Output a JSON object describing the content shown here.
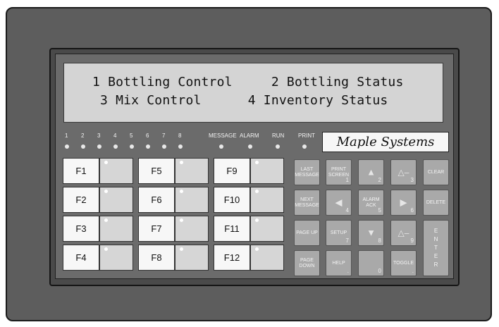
{
  "display": {
    "line1": "1 Bottling Control     2 Bottling Status",
    "line2": " 3 Mix Control      4 Inventory Status"
  },
  "indicators": {
    "numbers": [
      "1",
      "2",
      "3",
      "4",
      "5",
      "6",
      "7",
      "8"
    ],
    "message": "MESSAGE",
    "alarm": "ALARM",
    "run": "RUN",
    "print": "PRINT"
  },
  "logo": "Maple Systems",
  "function_keys": [
    "F1",
    "F2",
    "F3",
    "F4",
    "F5",
    "F6",
    "F7",
    "F8",
    "F9",
    "F10",
    "F11",
    "F12"
  ],
  "keypad": {
    "last_message": "LAST MESSAGE",
    "print_screen": "PRINT SCREEN",
    "print_screen_num": "1",
    "up_num": "2",
    "delta_minus_3": "△–",
    "delta_num_3": "3",
    "clear": "CLEAR",
    "next_message": "NEXT MESSAGE",
    "left_num": "4",
    "alarm_ack": "ALARM ACK",
    "alarm_ack_num": "5",
    "right_num": "6",
    "delete": "DELETE",
    "page_up": "PAGE UP",
    "setup": "SETUP",
    "setup_num": "7",
    "down_num": "8",
    "delta_minus_9": "△–",
    "delta_num_9": "9",
    "page_down": "PAGE DOWN",
    "help": "HELP",
    "help_sym": ".",
    "zero_num": "0",
    "toggle": "TOGGLE",
    "toggle_sym": ".",
    "enter": [
      "E",
      "N",
      "T",
      "E",
      "R"
    ]
  },
  "icons": {
    "up": "triangle-up-icon",
    "down": "triangle-down-icon",
    "left": "triangle-left-icon",
    "right": "triangle-right-icon"
  }
}
